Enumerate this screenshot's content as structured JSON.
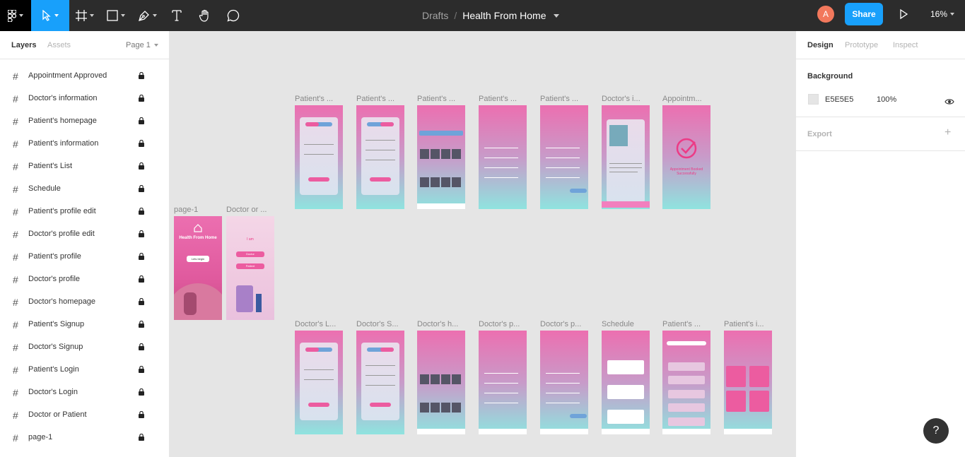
{
  "toolbar": {
    "breadcrumb_drafts": "Drafts",
    "breadcrumb_sep": "/",
    "file_name": "Health From Home",
    "avatar_initial": "A",
    "share_label": "Share",
    "zoom_label": "16%"
  },
  "left_panel": {
    "tab_layers": "Layers",
    "tab_assets": "Assets",
    "page_selector": "Page 1",
    "layers": [
      "Appointment Approved",
      "Doctor's information",
      "Patient's homepage",
      "Patient's information",
      "Patient's List",
      "Schedule",
      "Patient's profile edit",
      "Doctor's profile edit",
      "Patient's profile",
      "Doctor's profile",
      "Doctor's homepage",
      "Patient's Signup",
      "Doctor's Signup",
      "Patient's Login",
      "Doctor's Login",
      "Doctor or Patient",
      "page-1"
    ]
  },
  "right_panel": {
    "tab_design": "Design",
    "tab_prototype": "Prototype",
    "tab_inspect": "Inspect",
    "background_title": "Background",
    "background_hex": "E5E5E5",
    "background_opacity": "100%",
    "export_title": "Export",
    "export_add": "+"
  },
  "canvas": {
    "row1_labels": [
      "Patient's ...",
      "Patient's ...",
      "Patient's ...",
      "Patient's ...",
      "Patient's ...",
      "Doctor's i...",
      "Appointm..."
    ],
    "row2_labels": [
      "page-1",
      "Doctor or ..."
    ],
    "row3_labels": [
      "Doctor's L...",
      "Doctor's S...",
      "Doctor's h...",
      "Doctor's p...",
      "Doctor's p...",
      "Schedule",
      "Patient's ...",
      "Patient's i..."
    ],
    "page1_text": "Health From Home",
    "page1_button": "Lets begin",
    "dop_text": "I am",
    "dop_btn_a": "Doctor",
    "dop_btn_b": "Patient",
    "approved_text": "Appointment Booked Successfully"
  },
  "help": {
    "label": "?"
  },
  "colors": {
    "accent": "#18a0fb",
    "toolbar_bg": "#2c2c2c",
    "canvas_bg": "#E5E5E5",
    "frame_pink": "#ec6fb0",
    "frame_teal": "#8fe3df"
  }
}
